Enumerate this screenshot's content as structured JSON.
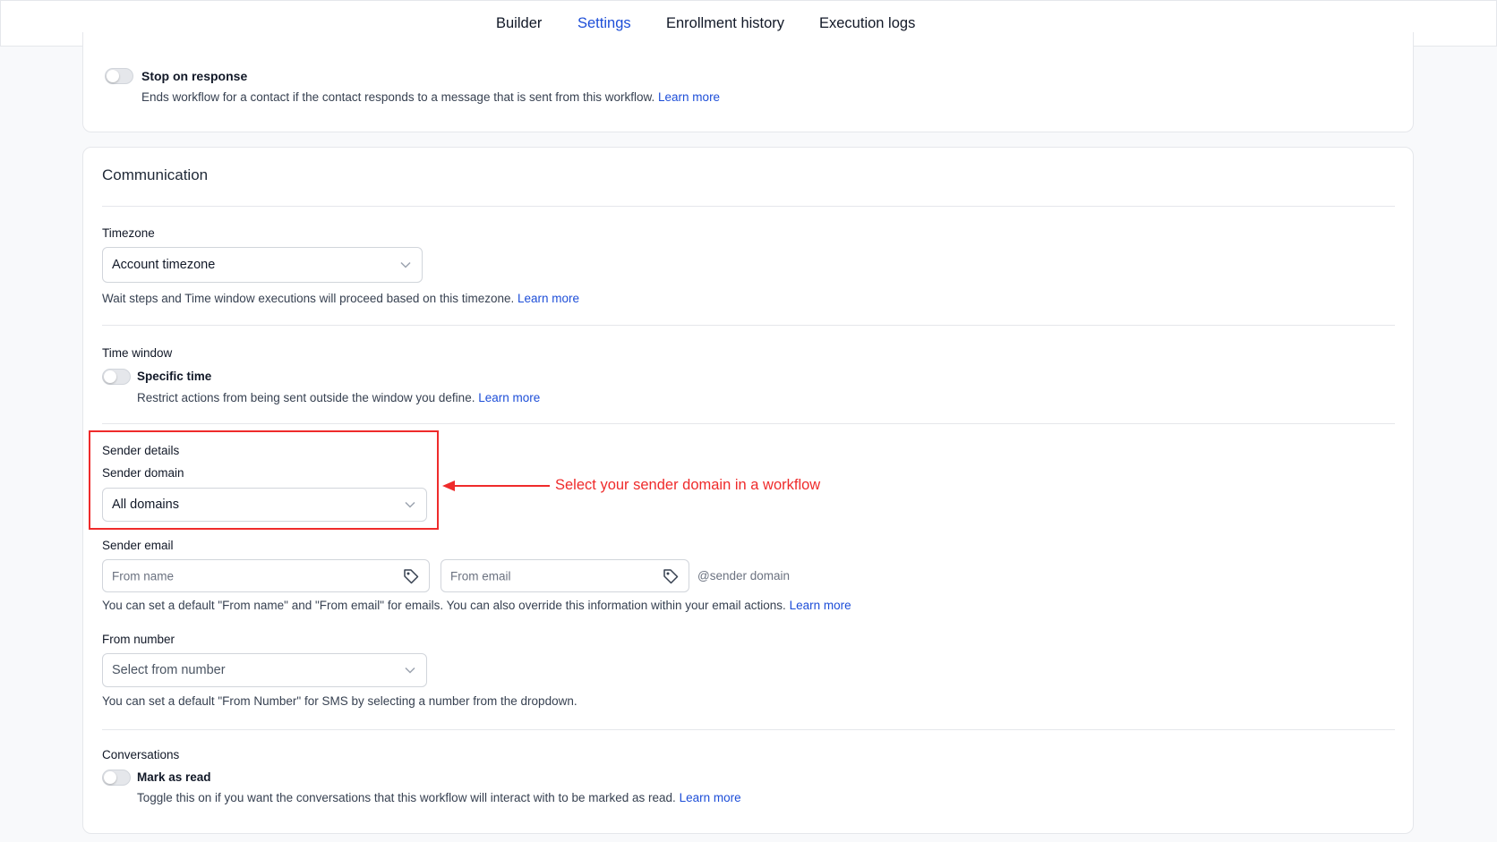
{
  "tabs": [
    {
      "label": "Builder"
    },
    {
      "label": "Settings",
      "active": true
    },
    {
      "label": "Enrollment history"
    },
    {
      "label": "Execution logs"
    }
  ],
  "stop_on_response": {
    "title": "Stop on response",
    "description": "Ends workflow for a contact if the contact responds to a message that is sent from this workflow.",
    "link": "Learn more",
    "enabled": false
  },
  "communication": {
    "title": "Communication",
    "timezone": {
      "label": "Timezone",
      "value": "Account timezone",
      "description": "Wait steps and Time window executions will proceed based on this timezone.",
      "link": "Learn more"
    },
    "time_window": {
      "label": "Time window",
      "toggle_title": "Specific time",
      "description": "Restrict actions from being sent outside the window you define.",
      "link": "Learn more",
      "enabled": false
    },
    "sender_details": {
      "label": "Sender details",
      "domain_label": "Sender domain",
      "domain_value": "All domains"
    },
    "sender_email": {
      "label": "Sender email",
      "from_name_placeholder": "From name",
      "from_email_placeholder": "From email",
      "suffix": "@sender domain",
      "description": "You can set a default \"From name\" and \"From email\" for emails. You can also override this information within your email actions.",
      "link": "Learn more"
    },
    "from_number": {
      "label": "From number",
      "placeholder": "Select from number",
      "description": "You can set a default \"From Number\" for SMS by selecting a number from the dropdown."
    },
    "conversations": {
      "label": "Conversations",
      "toggle_title": "Mark as read",
      "description": "Toggle this on if you want the conversations that this workflow will interact with to be marked as read.",
      "link": "Learn more",
      "enabled": false
    }
  },
  "annotation": {
    "text": "Select your sender domain in a workflow",
    "color": "#ef2b2b"
  },
  "colors": {
    "accent": "#1d4ed8",
    "annotation": "#ef2b2b"
  }
}
